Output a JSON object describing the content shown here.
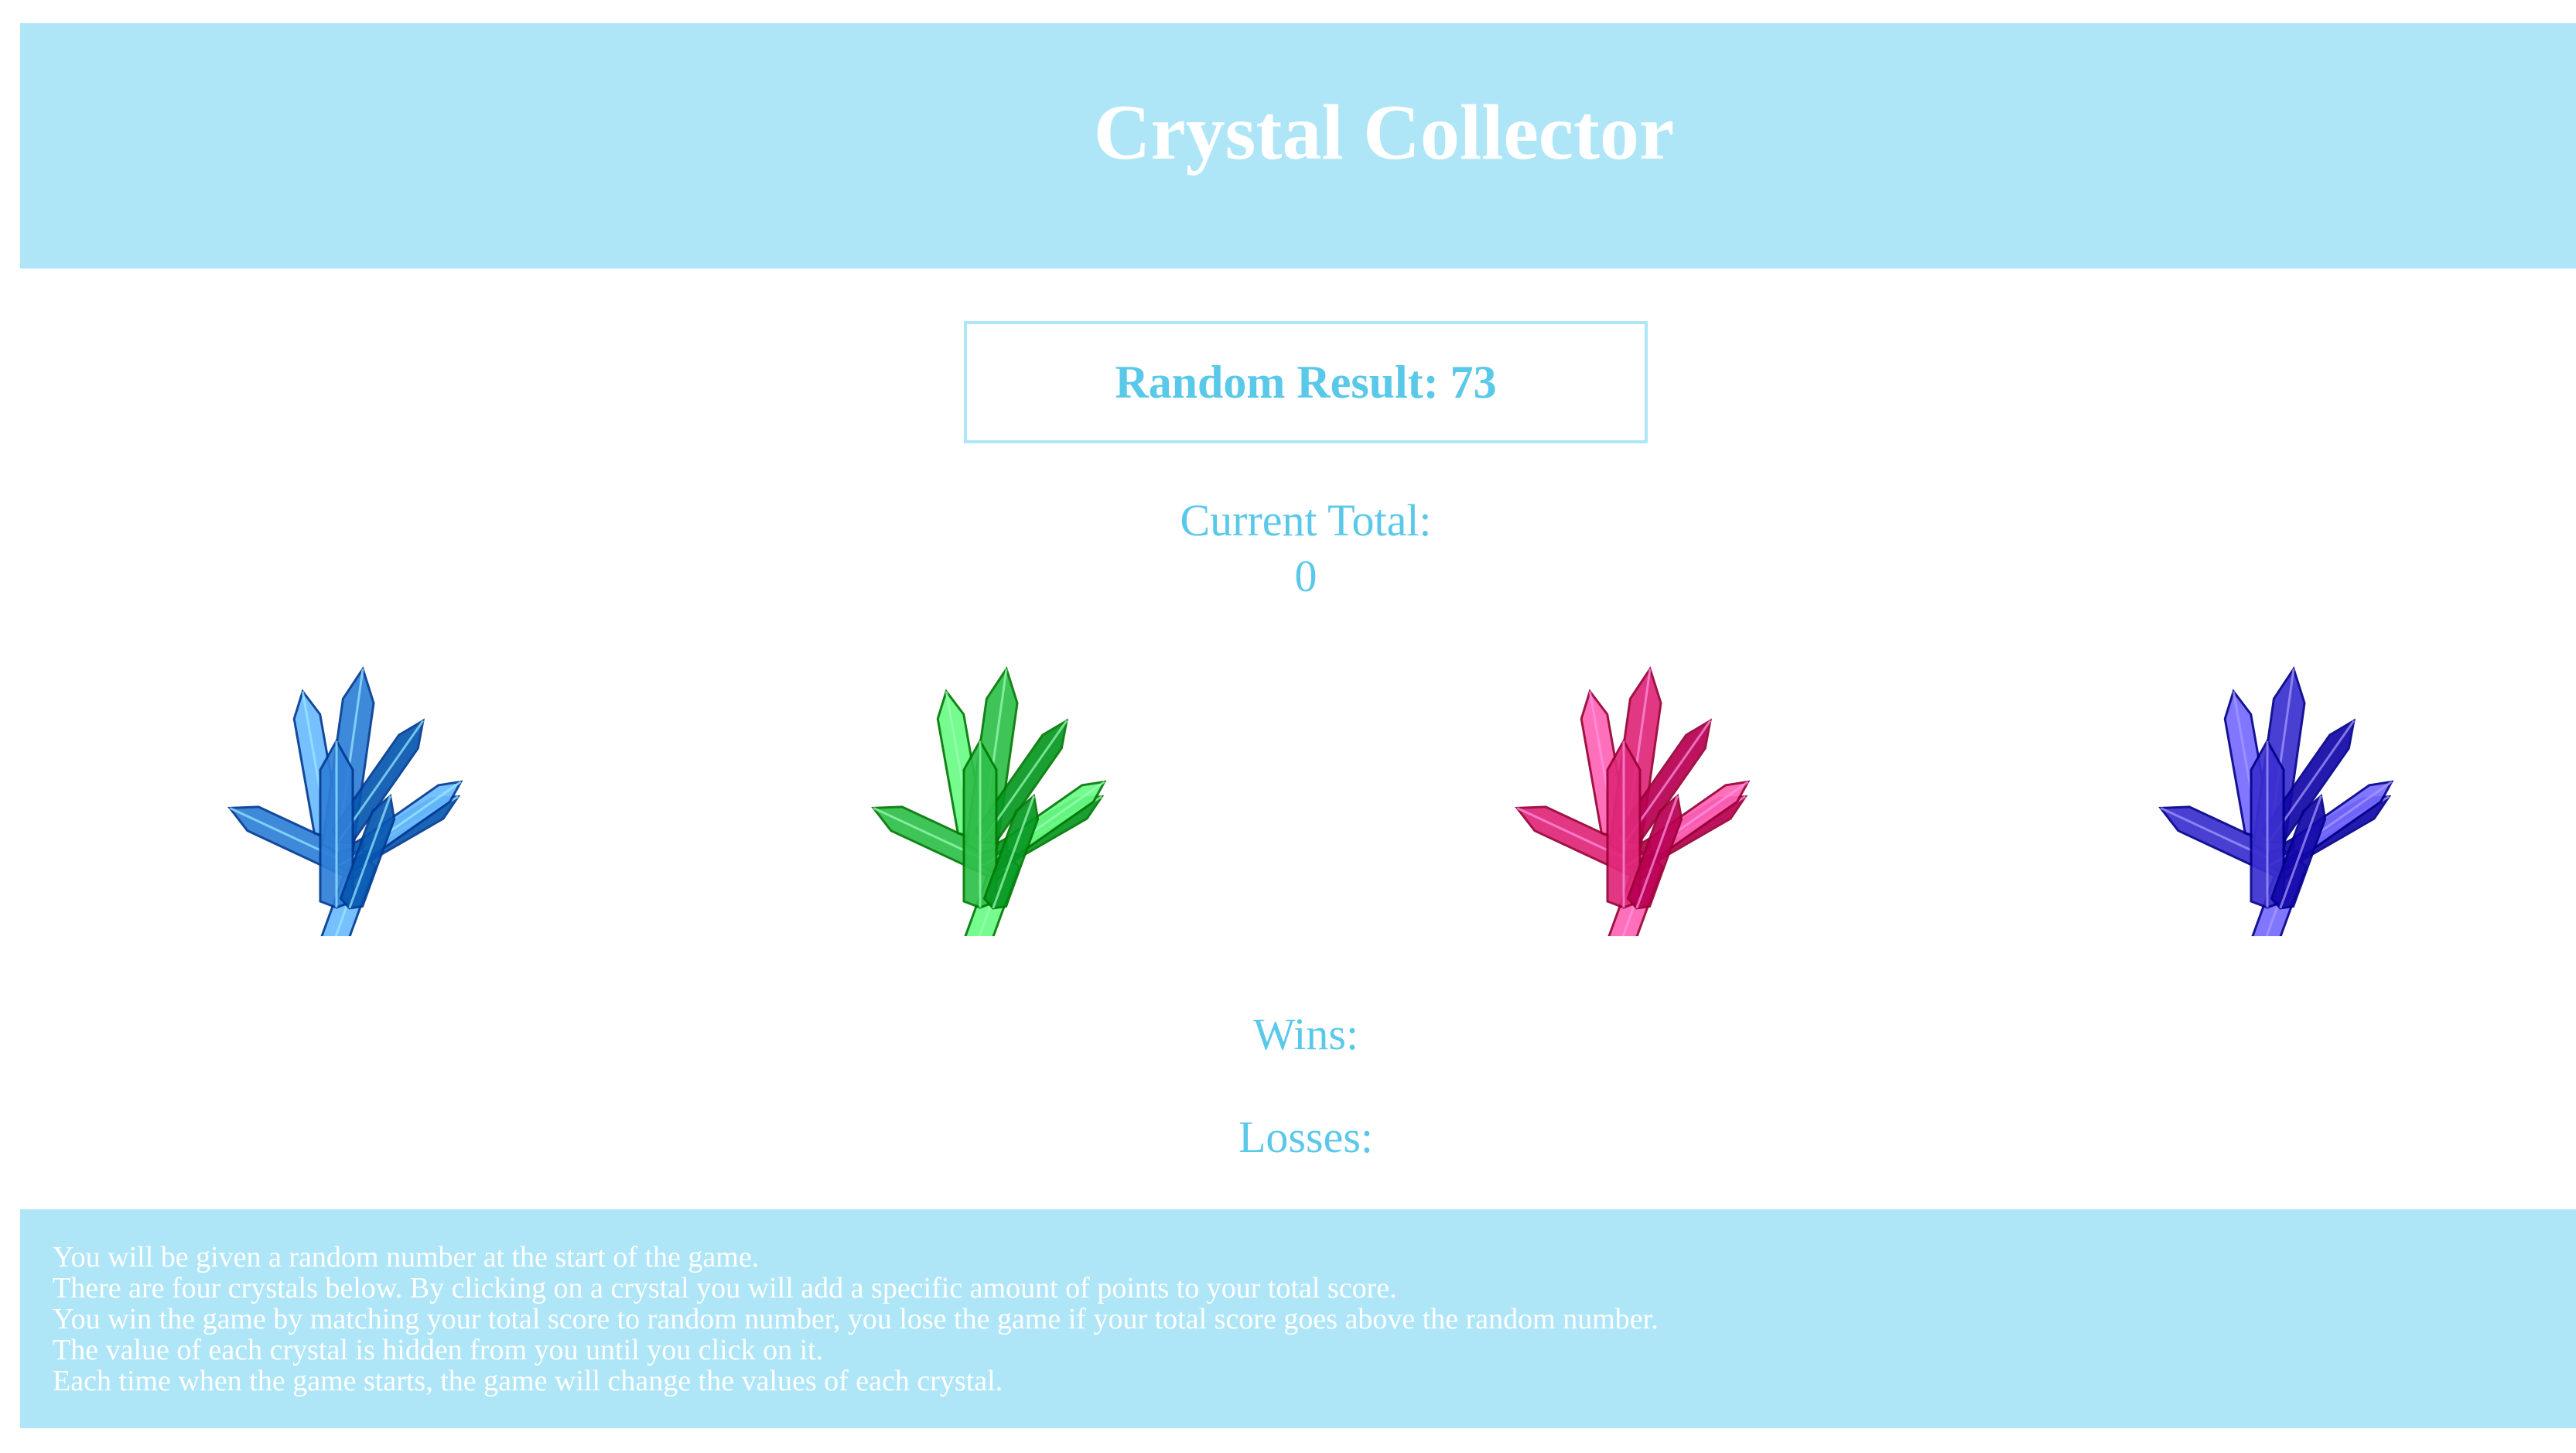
{
  "header": {
    "title": "Crystal Collector"
  },
  "game": {
    "random_result_label": "Random Result: 73",
    "current_total_label": "Current Total:",
    "current_total_value": "0",
    "wins_label": "Wins:",
    "losses_label": "Losses:"
  },
  "crystals": [
    {
      "name": "blue-crystal",
      "color": "#2f7fd8"
    },
    {
      "name": "green-crystal",
      "color": "#2fbf4a"
    },
    {
      "name": "pink-crystal",
      "color": "#e0287a"
    },
    {
      "name": "purple-crystal",
      "color": "#3b2fd0"
    }
  ],
  "instructions": [
    "You will be given a random number at the start of the game.",
    "There are four crystals below. By clicking on a crystal you will add a specific amount of points to your total score.",
    "You win the game by matching your total score to random number, you lose the game if your total score goes above the random number.",
    "The value of each crystal is hidden from you until you click on it.",
    "Each time when the game starts, the game will change the values of each crystal."
  ],
  "colors": {
    "panel": "#aee6f8",
    "accent_text": "#5ac8e8",
    "background": "#ffffff"
  }
}
